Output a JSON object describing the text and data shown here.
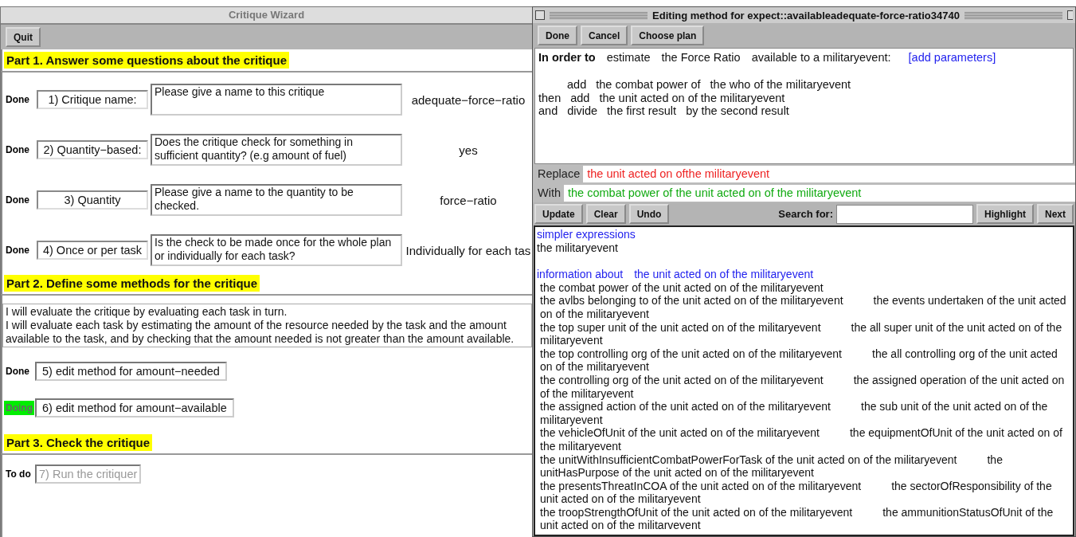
{
  "wizard": {
    "title": "Critique Wizard",
    "toolbar": [
      "Quit"
    ],
    "part1": {
      "heading": "Part 1.  Answer some questions about the critique",
      "questions": [
        {
          "status": "Done",
          "kind": "done",
          "label": "1) Critique name:",
          "prompt": "Please give a name to this critique",
          "answer": "adequate−force−ratio"
        },
        {
          "status": "Done",
          "kind": "done",
          "label": "2) Quantity−based:",
          "prompt": "Does the critique check for something in sufficient quantity? (e.g amount of fuel)",
          "answer": "yes"
        },
        {
          "status": "Done",
          "kind": "done",
          "label": "3) Quantity",
          "prompt": "Please give a name to the quantity to be checked.",
          "answer": "force−ratio"
        },
        {
          "status": "Done",
          "kind": "done",
          "label": "4) Once or per task",
          "prompt": "Is the check to be made once for the whole plan or individually for each task?",
          "answer": "Individually for each tas"
        }
      ]
    },
    "part2": {
      "heading": "Part 2.  Define some methods for the critique",
      "description": [
        "I will evaluate the critique by evaluating each task in turn.",
        "I will evaluate each task by estimating the amount of the resource needed by the task and the amount available to the task, and by checking that the amount needed is not greater than the amount available."
      ],
      "steps": [
        {
          "status": "Done",
          "kind": "done",
          "label": "5) edit method for amount−needed"
        },
        {
          "status": "Doing",
          "kind": "doing",
          "label": "6) edit method for amount−available"
        }
      ]
    },
    "part3": {
      "heading": "Part 3.  Check the critique",
      "steps": [
        {
          "status": "To do",
          "kind": "todo",
          "label": "7) Run the critiquer"
        }
      ]
    }
  },
  "editor": {
    "title": "Editing method for expect::availableadequate-force-ratio34740",
    "toolbar": [
      "Done",
      "Cancel",
      "Choose plan"
    ],
    "method": {
      "lead": "In order to",
      "goal": [
        "estimate",
        "the Force Ratio",
        "available to a militaryevent:"
      ],
      "link": "[add parameters]",
      "lines": [
        {
          "parts": [
            "add",
            "the combat power of",
            "the who of the militaryevent"
          ]
        },
        {
          "connector": "then",
          "parts": [
            "add",
            "the unit acted on of the militaryevent"
          ]
        },
        {
          "connector": "and",
          "parts": [
            "divide",
            "the first result",
            "by the second result"
          ]
        }
      ]
    },
    "replace": {
      "label": "Replace",
      "value": "the unit acted on ofthe militaryevent"
    },
    "with": {
      "label": "With",
      "value": "the combat power of the unit acted on of the militaryevent"
    },
    "actions": [
      "Update",
      "Clear",
      "Undo"
    ],
    "search": {
      "label": "Search for:",
      "buttons": [
        "Highlight",
        "Next"
      ]
    },
    "results": {
      "simpler_heading": "simpler expressions",
      "simpler": [
        "the militaryevent"
      ],
      "info_heading": [
        "information about",
        "the unit acted on of the militaryevent"
      ],
      "info_rows": [
        [
          "the combat power of the unit acted on of the militaryevent"
        ],
        [
          "the avlbs belonging to of the unit acted on of the militaryevent",
          "the events undertaken of the unit acted on of the militaryevent"
        ],
        [
          "the top super unit of the unit acted on of the militaryevent",
          "the all super unit of the unit acted on of the militaryevent"
        ],
        [
          "the top controlling org of the unit acted on of the militaryevent",
          "the all controlling org of the unit acted on of the militaryevent"
        ],
        [
          "the controlling org of the unit acted on of the militaryevent",
          "the assigned operation of the unit acted on of the militaryevent"
        ],
        [
          "the assigned action of the unit acted on of the militaryevent",
          "the sub unit of the unit acted on of the militaryevent"
        ],
        [
          "the vehicleOfUnit of the unit acted on of the militaryevent",
          "the equipmentOfUnit of the unit acted on of the militaryevent"
        ],
        [
          "the unitWithInsufficientCombatPowerForTask of the unit acted on of the militaryevent",
          "the unitHasPurpose of the unit acted on of the militaryevent"
        ],
        [
          "the presentsThreatInCOA of the unit acted on of the militaryevent",
          "the sectorOfResponsibility of the unit acted on of the militaryevent"
        ],
        [
          "the troopStrengthOfUnit of the unit acted on of the militaryevent",
          "the ammunitionStatusOfUnit of the unit acted on of the militarvevent"
        ]
      ]
    }
  }
}
